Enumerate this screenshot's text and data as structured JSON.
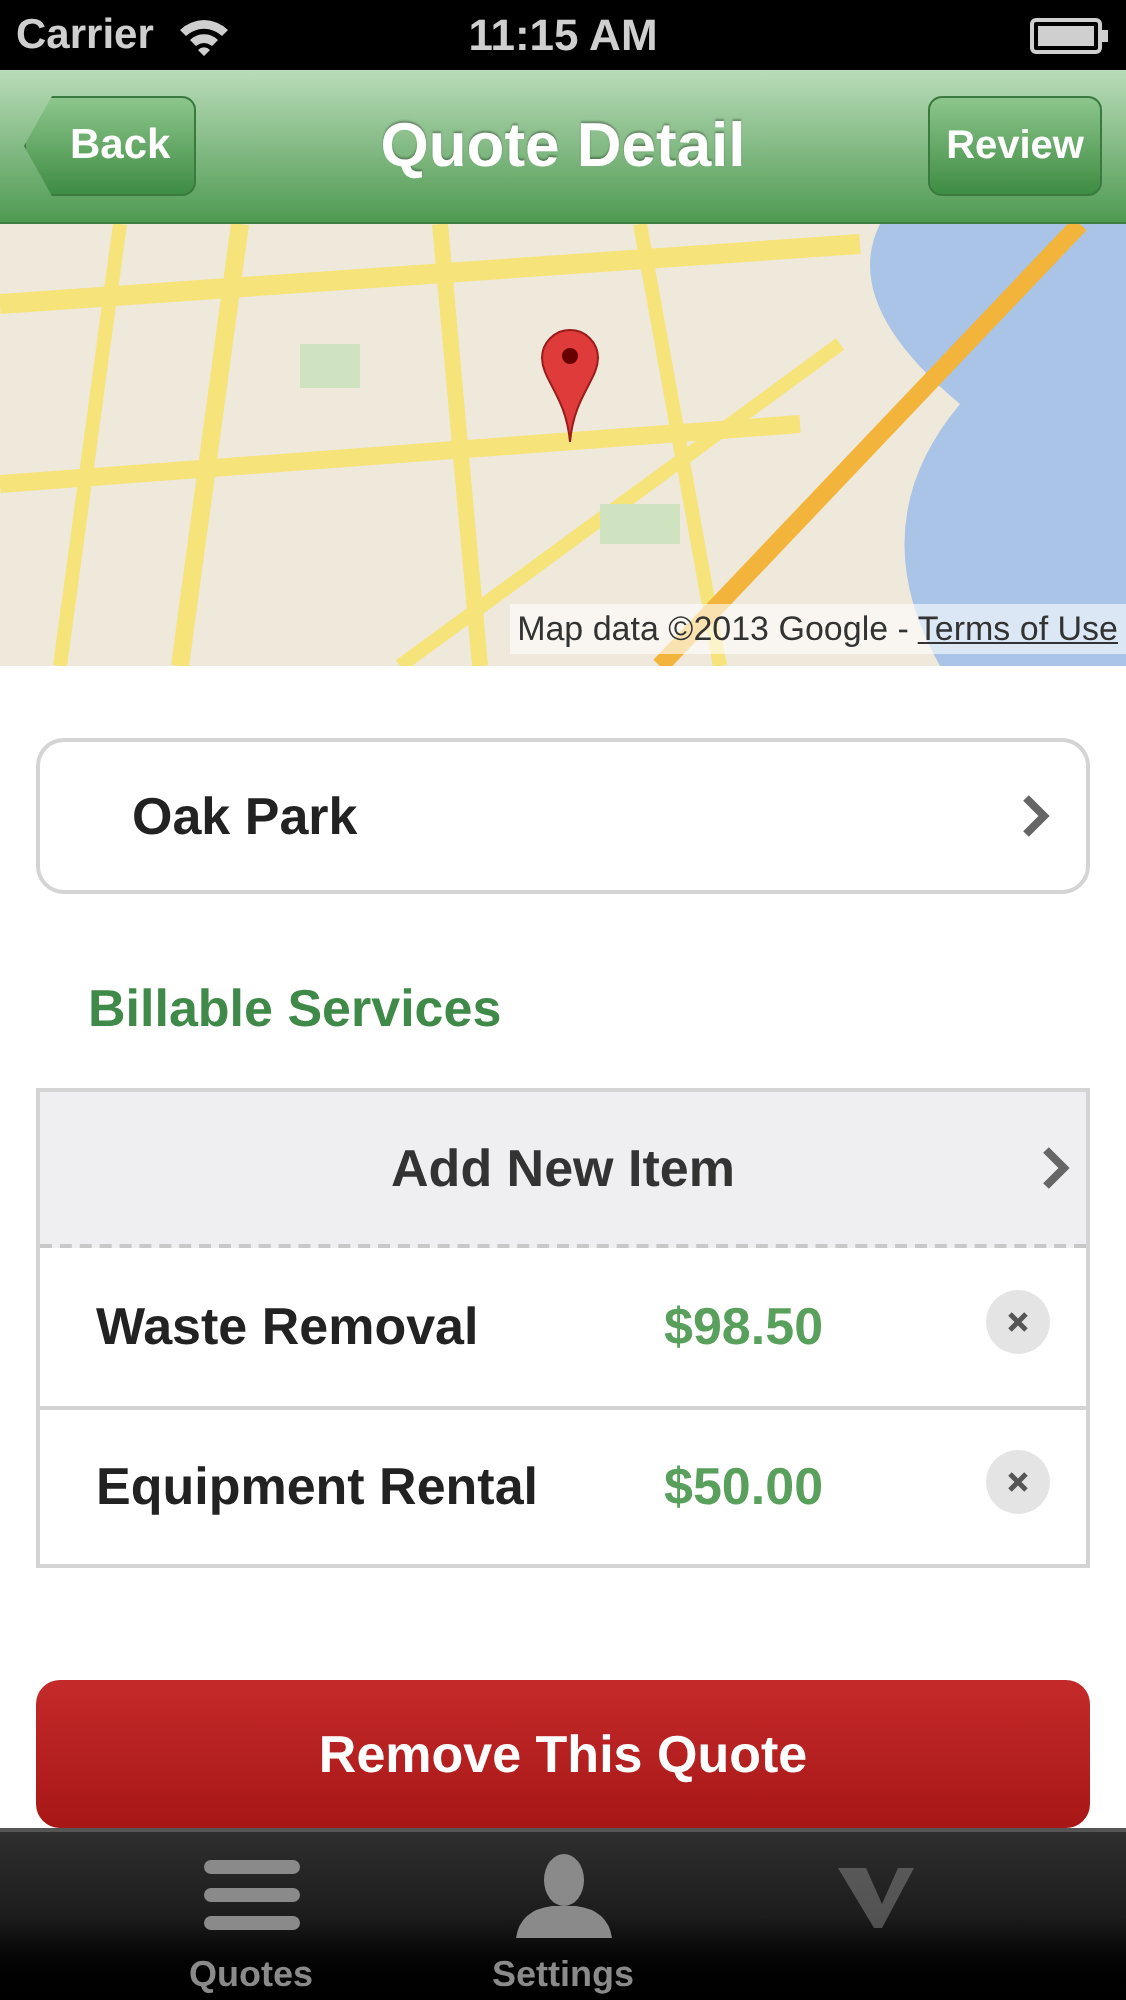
{
  "status_bar": {
    "carrier": "Carrier",
    "time": "11:15 AM"
  },
  "nav_bar": {
    "back": "Back",
    "title": "Quote Detail",
    "action": "Review"
  },
  "map": {
    "kind": "picture",
    "attribution": "Map data ©2013 Google - ",
    "terms_link": "Terms of Use"
  },
  "location": {
    "name": "Oak Park"
  },
  "billable_services": {
    "heading": "Billable Services",
    "add_item": "Add New Item",
    "items": [
      {
        "name": "Waste Removal",
        "price": "$98.50"
      },
      {
        "name": "Equipment Rental",
        "price": "$50.00"
      }
    ]
  },
  "remove_button": "Remove This Quote",
  "tab_bar": [
    {
      "kind": "list",
      "label": "Quotes",
      "selected": false
    },
    {
      "kind": "person",
      "label": "Settings",
      "selected": false
    },
    {
      "kind": "logo",
      "selected": false
    }
  ]
}
